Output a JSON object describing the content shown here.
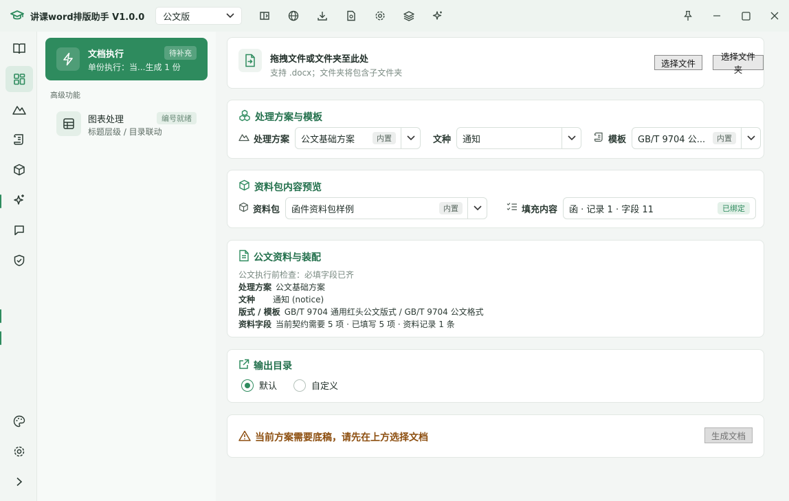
{
  "app": {
    "title": "讲课word排版助手 V1.0.0",
    "edition": "公文版"
  },
  "nav": {
    "active_card": {
      "title": "文档执行",
      "subtitle": "单份执行：当...生成 1 份",
      "badge": "待补充"
    },
    "section_label": "高级功能",
    "item": {
      "title": "图表处理",
      "subtitle": "标题层级 / 目录联动",
      "badge": "编号就绪"
    }
  },
  "drop": {
    "title": "拖拽文件或文件夹至此处",
    "hint": "支持 .docx；文件夹将包含子文件夹",
    "choose_file": "选择文件",
    "choose_folder": "选择文件夹"
  },
  "scheme": {
    "section_title": "处理方案与模板",
    "scheme_label": "处理方案",
    "scheme_value": "公文基础方案",
    "scheme_tag": "内置",
    "doctype_label": "文种",
    "doctype_value": "通知",
    "template_label": "模板",
    "template_value": "GB/T 9704 公...",
    "template_tag": "内置"
  },
  "package": {
    "section_title": "资料包内容预览",
    "pkg_label": "资料包",
    "pkg_value": "函件资料包样例",
    "pkg_tag": "内置",
    "fill_label": "填充内容",
    "fill_value": "函 · 记录 1 · 字段 11",
    "fill_tag": "已绑定"
  },
  "assembly": {
    "section_title": "公文资料与装配",
    "precheck": "公文执行前检查：必填字段已齐",
    "lines": [
      {
        "k": "处理方案",
        "v": "公文基础方案"
      },
      {
        "k": "文种",
        "v": "通知 (notice)"
      },
      {
        "k": "版式 / 模板",
        "v": "GB/T 9704 通用红头公文版式 / GB/T 9704 公文格式"
      },
      {
        "k": "资料字段",
        "v": "当前契约需要 5 项 · 已填写 5 项 · 资料记录 1 条"
      }
    ]
  },
  "output": {
    "section_title": "输出目录",
    "opt_default": "默认",
    "opt_custom": "自定义"
  },
  "footer": {
    "warning": "当前方案需要底稿，请先在上方选择文档",
    "generate": "生成文档"
  },
  "colors": {
    "accent": "#2e8b5e",
    "warning": "#8d4f10"
  }
}
